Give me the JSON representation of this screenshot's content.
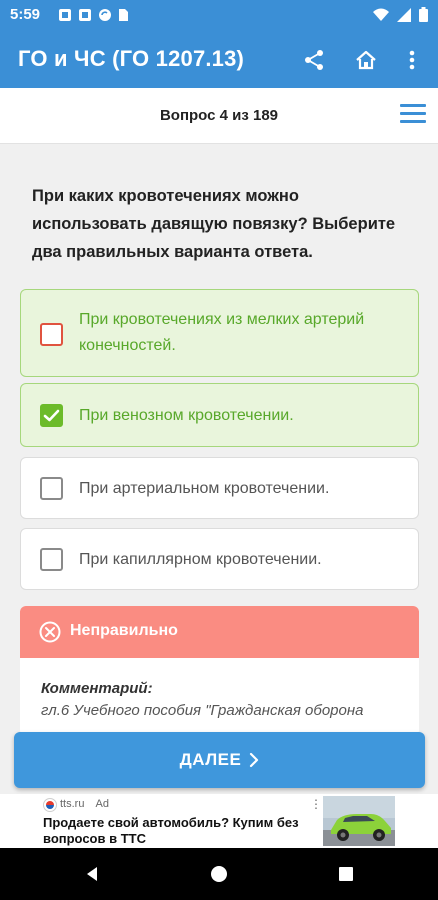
{
  "status_bar": {
    "time": "5:59",
    "icons": [
      "notification-square-icon",
      "notification-square-icon",
      "sync-icon",
      "sd-card-icon",
      "wifi-icon",
      "signal-icon",
      "battery-icon"
    ]
  },
  "app_bar": {
    "title": "ГО и ЧС (ГО 1207.13)",
    "actions": [
      "share-icon",
      "home-icon",
      "more-vert-icon"
    ]
  },
  "question_header": {
    "counter": "Вопрос 4 из 189",
    "menu_icon": "hamburger-menu-icon"
  },
  "question": {
    "text": "При каких кровотечениях можно использовать давящую повязку? Выберите два правильных варианта ответа."
  },
  "options": [
    {
      "text": "При кровотечениях из мелких артерий конечностей.",
      "state": "correct-unchecked"
    },
    {
      "text": "При венозном кровотечении.",
      "state": "correct-checked"
    },
    {
      "text": "При артериальном кровотечении.",
      "state": "unchecked"
    },
    {
      "text": "При капиллярном кровотечении.",
      "state": "unchecked"
    }
  ],
  "result": {
    "title": "Неправильно",
    "icon": "x-circle-icon",
    "comment_label": "Комментарий:",
    "comment_text": "гл.6 Учебного пособия \"Гражданская оборона"
  },
  "next_button": {
    "label": "ДАЛЕЕ",
    "icon": "chevron-right-icon"
  },
  "ad": {
    "domain": "tts.ru",
    "badge": "Ad",
    "title": "Продаете свой автомобиль? Купим без вопросов в ТТС",
    "more": "⋮"
  },
  "nav_bar": {
    "buttons": [
      "back-triangle-icon",
      "home-circle-icon",
      "recents-square-icon"
    ]
  },
  "colors": {
    "primary": "#3b8fd6",
    "correct_bg": "#e9f5dc",
    "correct_text": "#58a82a",
    "error_header": "#fa8c82"
  }
}
